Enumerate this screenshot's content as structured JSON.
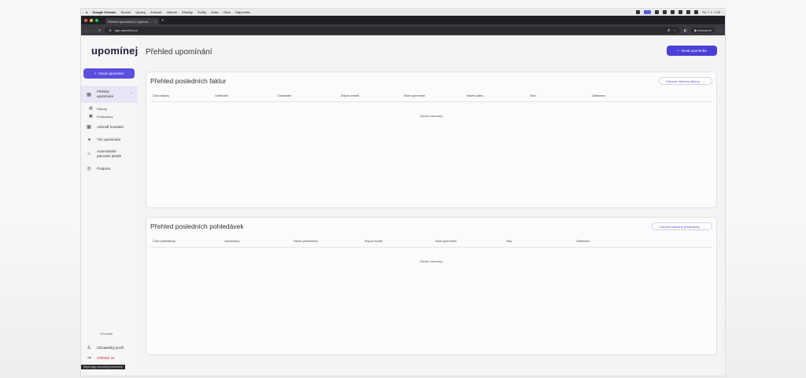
{
  "macos": {
    "menu": [
      "Google Chrome",
      "Soubor",
      "Úpravy",
      "Zobrazit",
      "Historie",
      "Záložky",
      "Profily",
      "Karta",
      "Okno",
      "Nápověda"
    ],
    "clock": "Po 7. 1. 7:23"
  },
  "browser": {
    "tab_title": "Přehled upomínání | Upomín…",
    "url": "app.upominej.cz",
    "profile_label": "Anonymní"
  },
  "sidebar": {
    "logo": "upomínej",
    "new_button": "Nová upomínka",
    "items": [
      {
        "label": "Přehled upomínání",
        "icon": "grid-icon"
      },
      {
        "label": "Adresář kontaktů",
        "icon": "contacts-icon"
      },
      {
        "label": "Tón upomínání",
        "icon": "megaphone-icon"
      },
      {
        "label": "Automatické párování plateb",
        "icon": "bank-icon"
      },
      {
        "label": "Podpora",
        "icon": "help-icon"
      }
    ],
    "subitems": [
      {
        "label": "Faktury",
        "icon": "invoice-icon"
      },
      {
        "label": "Pohledávky",
        "icon": "document-icon"
      }
    ],
    "company": "UTmoule",
    "user_profile": "Uživatelský profil",
    "logout": "Odhlásit se",
    "status_tooltip": "https://app.upominej.cz/invoices"
  },
  "main": {
    "title": "Přehled upomínání",
    "new_button": "Nová upomínka",
    "invoices": {
      "title": "Přehled posledních faktur",
      "view_all": "Zobrazit všechny faktury",
      "columns": [
        "Číslo faktury",
        "Odběratel",
        "Dodavatel",
        "Zbývá uhradit",
        "Start upomínání",
        "Název plánu",
        "Stav",
        "Odbaveno"
      ],
      "empty": "Žádné záznamy"
    },
    "receivables": {
      "title": "Přehled posledních pohledávek",
      "view_all": "Zobrazit všechny pohledávky",
      "columns": [
        "Číslo pohledávky",
        "Upomínaný",
        "Název pohledávky",
        "Zbývá uhradit",
        "Start upomínání",
        "Stav",
        "Odbaveno"
      ],
      "empty": "Žádné záznamy"
    }
  },
  "colors": {
    "accent": "#5b4fe0",
    "accent_dark": "#4a3fd6",
    "logout": "#c0392b"
  }
}
